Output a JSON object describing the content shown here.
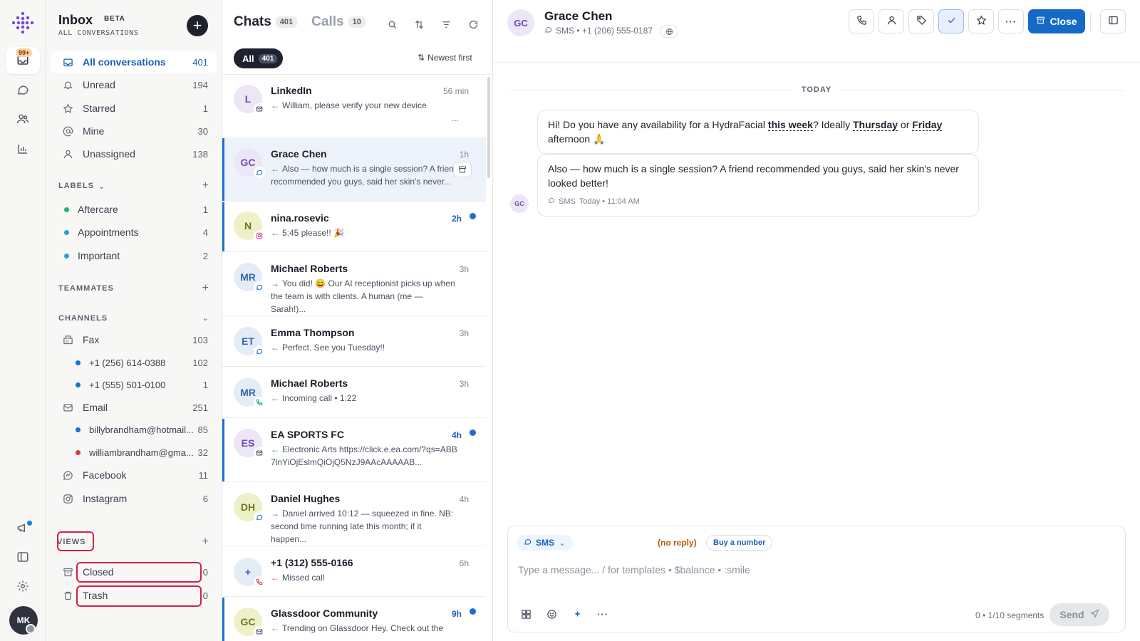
{
  "rail": {
    "badge": "99+",
    "avatar_initials": "MK"
  },
  "nav": {
    "title": "Inbox",
    "beta": "BETA",
    "subtitle": "ALL CONVERSATIONS",
    "main": [
      {
        "label": "All conversations",
        "count": "401"
      },
      {
        "label": "Unread",
        "count": "194"
      },
      {
        "label": "Starred",
        "count": "1"
      },
      {
        "label": "Mine",
        "count": "30"
      },
      {
        "label": "Unassigned",
        "count": "138"
      }
    ],
    "labels_heading": "LABELS",
    "labels": [
      {
        "label": "Aftercare",
        "count": "1",
        "color": "#1ab47a"
      },
      {
        "label": "Appointments",
        "count": "4",
        "color": "#2a9fd8"
      },
      {
        "label": "Important",
        "count": "2",
        "color": "#2a9fd8"
      }
    ],
    "teammates_heading": "TEAMMATES",
    "channels_heading": "CHANNELS",
    "channels": {
      "fax": {
        "label": "Fax",
        "count": "103"
      },
      "fax_numbers": [
        {
          "label": "+1 (256) 614-0388",
          "count": "102",
          "color": "#1c6fd1"
        },
        {
          "label": "+1 (555) 501-0100",
          "count": "1",
          "color": "#1c6fd1"
        }
      ],
      "email": {
        "label": "Email",
        "count": "251"
      },
      "email_accounts": [
        {
          "label": "billybrandham@hotmail...",
          "count": "85",
          "color": "#1c6fd1"
        },
        {
          "label": "williambrandham@gma...",
          "count": "32",
          "color": "#d63a3a"
        }
      ],
      "facebook": {
        "label": "Facebook",
        "count": "11"
      },
      "instagram": {
        "label": "Instagram",
        "count": "6"
      }
    },
    "views_heading": "VIEWS",
    "views": [
      {
        "label": "Closed",
        "count": "0"
      },
      {
        "label": "Trash",
        "count": "0"
      }
    ]
  },
  "list": {
    "tab_chats": "Chats",
    "tab_chats_count": "401",
    "tab_calls": "Calls",
    "tab_calls_count": "10",
    "filter_all": "All",
    "filter_all_count": "401",
    "sort_label": "Newest first",
    "items": [
      {
        "initials": "L",
        "name": "LinkedIn",
        "time": "56 min",
        "preview": "William, please verify your new device",
        "extra": "..."
      },
      {
        "initials": "GC",
        "name": "Grace Chen",
        "time": "1h",
        "preview": "Also — how much is a single session? A friend recommended you guys, said her skin's never..."
      },
      {
        "initials": "N",
        "name": "nina.rosevic",
        "time": "2h",
        "preview": "5:45 please!! 🎉"
      },
      {
        "initials": "MR",
        "name": "Michael Roberts",
        "time": "3h",
        "preview": "You did! 😄 Our AI receptionist picks up when the team is with clients. A human (me — Sarah!)..."
      },
      {
        "initials": "ET",
        "name": "Emma Thompson",
        "time": "3h",
        "preview": "Perfect. See you Tuesday!!"
      },
      {
        "initials": "MR",
        "name": "Michael Roberts",
        "time": "3h",
        "preview": "Incoming call • 1:22"
      },
      {
        "initials": "ES",
        "name": "EA SPORTS FC",
        "time": "4h",
        "preview": "Electronic Arts https://click.e.ea.com/?qs=ABB7lnYiOjEslmQiOjQ5NzJ9AAcAAAAAB..."
      },
      {
        "initials": "DH",
        "name": "Daniel Hughes",
        "time": "4h",
        "preview": "Daniel arrived 10:12 — squeezed in fine. NB: second time running late this month; if it happen..."
      },
      {
        "initials": "+",
        "name": "+1 (312) 555-0166",
        "time": "6h",
        "preview": "Missed call"
      },
      {
        "initials": "GC",
        "name": "Glassdoor Community",
        "time": "9h",
        "preview": "Trending on Glassdoor Hey. Check out the"
      }
    ]
  },
  "conversation": {
    "initials": "GC",
    "name": "Grace Chen",
    "subtitle": "SMS • +1 (206) 555-0187",
    "close_label": "Close",
    "day_label": "TODAY",
    "msg1": {
      "p1": "Hi! Do you have any availability for a HydraFacial ",
      "b1": "this week",
      "p2": "? Ideally ",
      "b2": "Thursday",
      "p3": " or ",
      "b3": "Friday",
      "p4": " afternoon 🙏"
    },
    "msg2": {
      "text": "Also — how much is a single session? A friend recommended you guys, said her skin's never looked better!",
      "channel": "SMS",
      "time": "Today • 11:04 AM"
    },
    "composer": {
      "channel": "SMS",
      "no_reply": "(no reply)",
      "buy_number": "Buy a number",
      "placeholder": "Type a message... / for templates • $balance • :smile",
      "segments": "0 • 1/10 segments",
      "send": "Send"
    }
  }
}
